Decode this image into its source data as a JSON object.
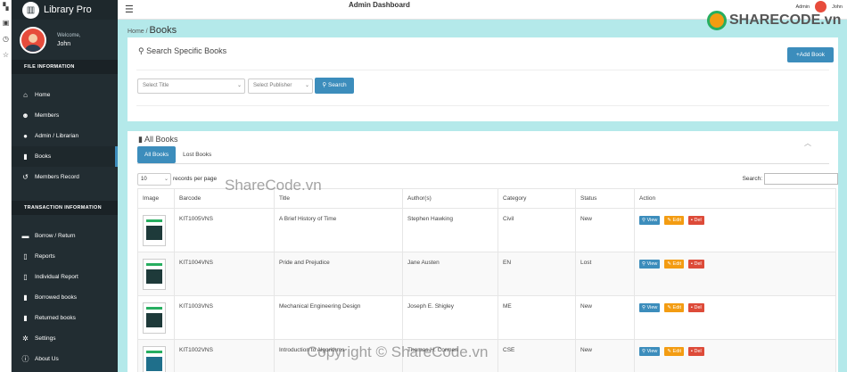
{
  "sidebar": {
    "brand": "Library Pro",
    "welcome": "Welcome,",
    "username": "John",
    "sections": {
      "file": "FILE INFORMATION",
      "transaction": "TRANSACTION INFORMATION"
    },
    "items": [
      {
        "label": "Home",
        "icon": "home-icon"
      },
      {
        "label": "Members",
        "icon": "users-icon"
      },
      {
        "label": "Admin / Librarian",
        "icon": "user-icon"
      },
      {
        "label": "Books",
        "icon": "book-icon"
      },
      {
        "label": "Members Record",
        "icon": "history-icon"
      },
      {
        "label": "Borrow / Return",
        "icon": "exchange-icon"
      },
      {
        "label": "Reports",
        "icon": "file-icon"
      },
      {
        "label": "Individual Report",
        "icon": "file-icon"
      },
      {
        "label": "Borrowed books",
        "icon": "book-icon"
      },
      {
        "label": "Returned books",
        "icon": "book-icon"
      },
      {
        "label": "Settings",
        "icon": "gear-icon"
      },
      {
        "label": "About Us",
        "icon": "info-icon"
      }
    ]
  },
  "header": {
    "title": "Admin Dashboard",
    "role": "Admin",
    "user": "John"
  },
  "breadcrumb": {
    "home": "Home /",
    "page": "Books"
  },
  "search_panel": {
    "title": "Search Specific Books",
    "add_button": "Add Book",
    "title_placeholder": "Select Title",
    "publisher_placeholder": "Select Publisher",
    "search_button": "Search"
  },
  "books_panel": {
    "title": "All Books",
    "tabs": [
      "All Books",
      "Lost Books"
    ],
    "page_length": "10",
    "length_label": "records per page",
    "search_label": "Search:",
    "columns": [
      "Image",
      "Barcode",
      "Title",
      "Author(s)",
      "Category",
      "Status",
      "Action"
    ],
    "rows": [
      {
        "barcode": "KIT1005VNS",
        "title": "A Brief History of Time",
        "author": "Stephen Hawking",
        "category": "Civil",
        "status": "New"
      },
      {
        "barcode": "KIT1004VNS",
        "title": "Pride and Prejudice",
        "author": "Jane Austen",
        "category": "EN",
        "status": "Lost"
      },
      {
        "barcode": "KIT1003VNS",
        "title": "Mechanical Engineering Design",
        "author": "Joseph E. Shigley",
        "category": "ME",
        "status": "New"
      },
      {
        "barcode": "KIT1002VNS",
        "title": "Introduction to Algorithms",
        "author": "Thomas H. Cormen",
        "category": "CSE",
        "status": "New"
      }
    ],
    "actions": {
      "view": "View",
      "edit": "Edit",
      "delete": "Del"
    }
  },
  "watermarks": {
    "center": "ShareCode.vn",
    "bottom": "Copyright © ShareCode.vn",
    "logo": "SHARECODE.vn"
  }
}
